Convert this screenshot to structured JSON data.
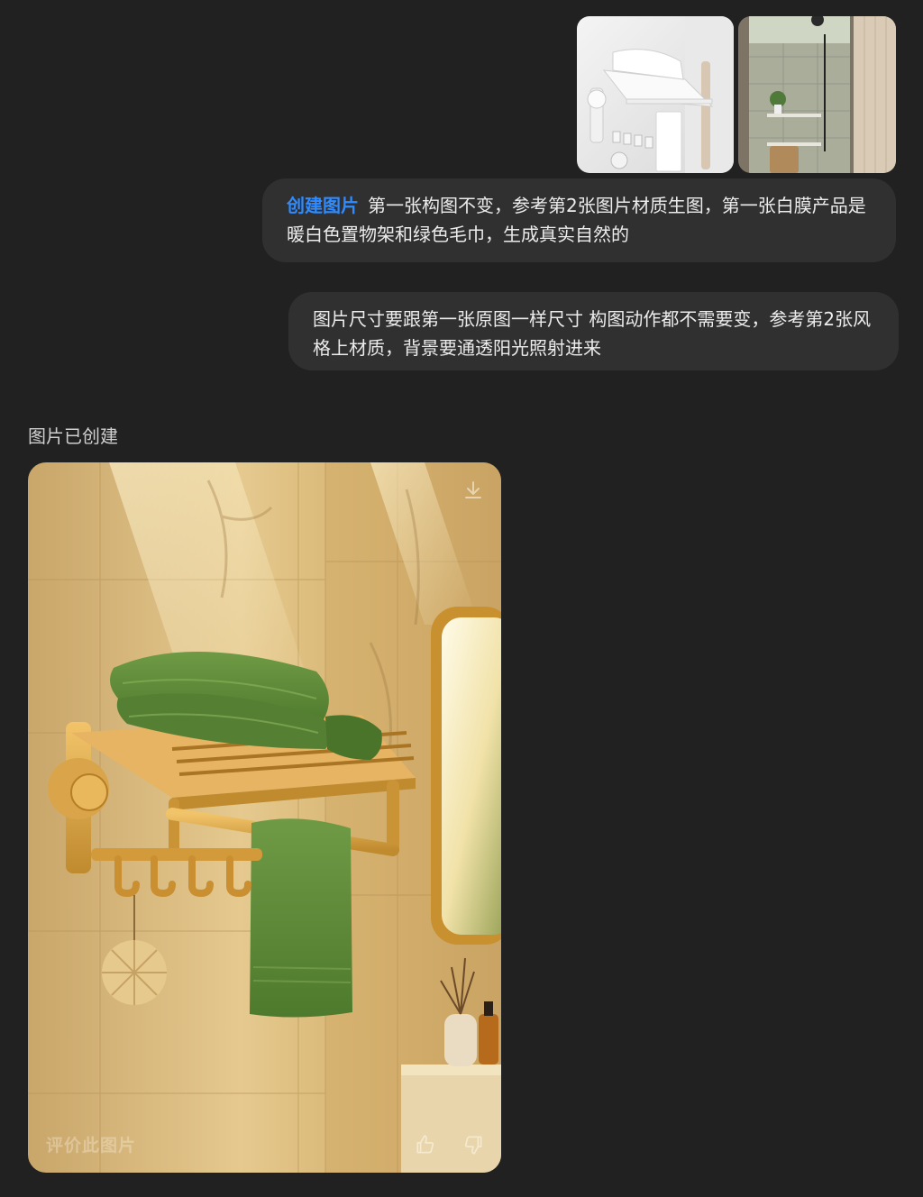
{
  "conversation": {
    "attachments": [
      {
        "icon": "white-towel-rack-image"
      },
      {
        "icon": "bathroom-shower-image"
      }
    ],
    "message1": {
      "tag": "创建图片",
      "text": "第一张构图不变，参考第2张图片材质生图，第一张白膜产品是暖白色置物架和绿色毛巾，生成真实自然的"
    },
    "message2": {
      "text": "图片尺寸要跟第一张原图一样尺寸 构图动作都不需要变，参考第2张风格上材质，背景要通透阳光照射进来"
    },
    "status": "图片已创建",
    "generated_image": {
      "rate_label": "评价此图片",
      "download_icon": "download-icon",
      "like_icon": "thumbs-up-icon",
      "dislike_icon": "thumbs-down-icon"
    }
  },
  "colors": {
    "background": "#212121",
    "bubble": "#303030",
    "accent": "#2f8bff",
    "towel_green": "#5f8a3a",
    "rack_gold": "#d39a3c"
  }
}
